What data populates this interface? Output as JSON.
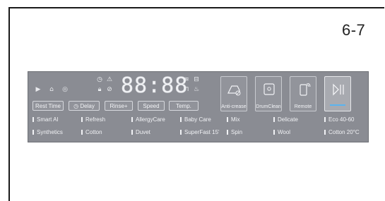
{
  "page_number": "6-7",
  "panel": {
    "display": "88:88",
    "top_icons": [
      "play-step-icon",
      "shirt-icon",
      "drum-icon"
    ],
    "left_status_icons": [
      "clock-icon",
      "warning-icon",
      "lock-icon",
      "timer-icon"
    ],
    "right_status_icons": [
      "wifi-icon",
      "tray-icon",
      "child-lock-icon",
      "rinse-icon"
    ],
    "buttons": [
      "Rest Time",
      "Delay",
      "Rinse+",
      "Speed",
      "Temp.",
      "Anti-crease",
      "DrumClean",
      "Remote"
    ],
    "programs_row1": [
      "Smart AI",
      "Refresh",
      "AllergyCare",
      "Baby Care",
      "Mix",
      "Delicate",
      "Eco 40-60"
    ],
    "programs_row2": [
      "Synthetics",
      "Cotton",
      "Duvet",
      "SuperFast 15'",
      "Spin",
      "Wool",
      "Cotton 20°C"
    ]
  }
}
